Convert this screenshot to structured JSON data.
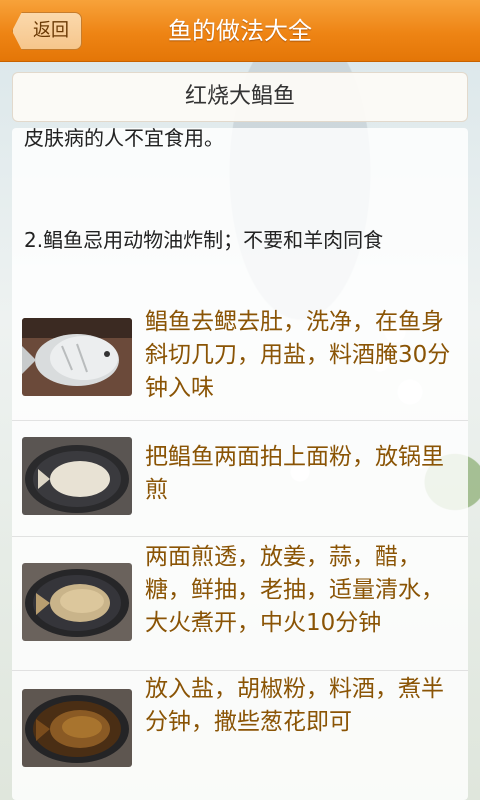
{
  "header": {
    "back_label": "返回",
    "title": "鱼的做法大全"
  },
  "recipe": {
    "name": "红烧大鲳鱼",
    "notes": [
      "皮肤病的人不宜食用。",
      "2.鲳鱼忌用动物油炸制；不要和羊肉同食"
    ],
    "steps": [
      {
        "text": "鲳鱼去鳃去肚，洗净，在鱼身斜切几刀，用盐，料酒腌30分钟入味",
        "image": "raw-fish-photo"
      },
      {
        "text": "把鲳鱼两面拍上面粉，放锅里煎",
        "image": "fish-in-pan-photo"
      },
      {
        "text": "两面煎透，放姜，蒜，醋，糖，鲜抽，老抽，适量清水，大火煮开，中火10分钟",
        "image": "fried-fish-photo"
      },
      {
        "text": "放入盐，胡椒粉，料酒，煮半分钟，撒些葱花即可",
        "image": "braised-fish-photo"
      }
    ]
  },
  "colors": {
    "header": "#ee8414",
    "step_text": "#8a5405"
  }
}
